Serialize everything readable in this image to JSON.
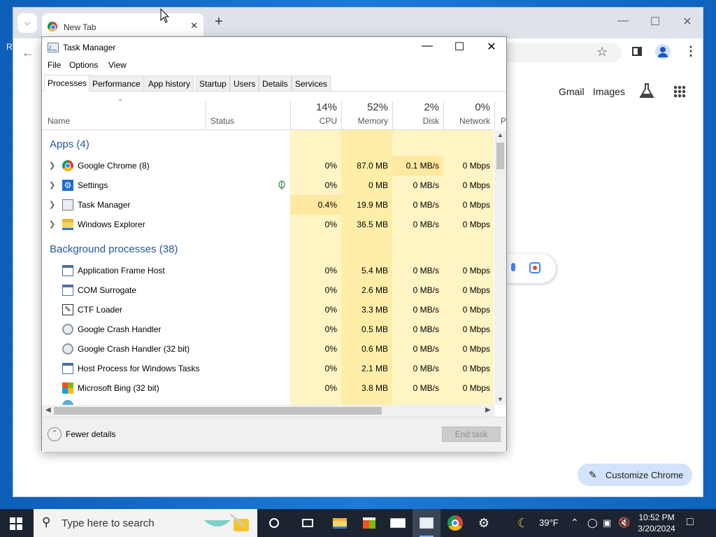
{
  "desktop": {
    "edge_text": "R"
  },
  "chrome": {
    "tab_list_icon": "chevron-down-icon",
    "tab": {
      "title": "New Tab",
      "close": "✕"
    },
    "new_tab": "+",
    "controls": {
      "minimize": "—",
      "maximize": "☐",
      "close": "✕"
    },
    "back": "←",
    "links": {
      "gmail": "Gmail",
      "images": "Images"
    },
    "customize_label": "Customize Chrome"
  },
  "task_manager": {
    "title": "Task Manager",
    "controls": {
      "minimize": "—",
      "maximize": "☐",
      "close": "✕"
    },
    "menu": [
      "File",
      "Options",
      "View"
    ],
    "tabs": [
      "Processes",
      "Performance",
      "App history",
      "Startup",
      "Users",
      "Details",
      "Services"
    ],
    "active_tab": "Processes",
    "columns": {
      "name": "Name",
      "status": "Status",
      "cpu": {
        "value": "14%",
        "label": "CPU"
      },
      "memory": {
        "value": "52%",
        "label": "Memory"
      },
      "disk": {
        "value": "2%",
        "label": "Disk"
      },
      "network": {
        "value": "0%",
        "label": "Network"
      },
      "power": "P"
    },
    "groups": {
      "apps": "Apps (4)",
      "background": "Background processes (38)"
    },
    "apps": [
      {
        "name": "Google Chrome (8)",
        "cpu": "0%",
        "memory": "87.0 MB",
        "disk": "0.1 MB/s",
        "network": "0 Mbps",
        "icon": "chrome-icon"
      },
      {
        "name": "Settings",
        "cpu": "0%",
        "memory": "0 MB",
        "disk": "0 MB/s",
        "network": "0 Mbps",
        "icon": "settings-gear-icon"
      },
      {
        "name": "Task Manager",
        "cpu": "0.4%",
        "memory": "19.9 MB",
        "disk": "0 MB/s",
        "network": "0 Mbps",
        "icon": "task-manager-icon"
      },
      {
        "name": "Windows Explorer",
        "cpu": "0%",
        "memory": "36.5 MB",
        "disk": "0 MB/s",
        "network": "0 Mbps",
        "icon": "folder-icon"
      }
    ],
    "background": [
      {
        "name": "Application Frame Host",
        "cpu": "0%",
        "memory": "5.4 MB",
        "disk": "0 MB/s",
        "network": "0 Mbps",
        "icon": "app-window-icon"
      },
      {
        "name": "COM Surrogate",
        "cpu": "0%",
        "memory": "2.6 MB",
        "disk": "0 MB/s",
        "network": "0 Mbps",
        "icon": "app-window-icon"
      },
      {
        "name": "CTF Loader",
        "cpu": "0%",
        "memory": "3.3 MB",
        "disk": "0 MB/s",
        "network": "0 Mbps",
        "icon": "pen-note-icon"
      },
      {
        "name": "Google Crash Handler",
        "cpu": "0%",
        "memory": "0.5 MB",
        "disk": "0 MB/s",
        "network": "0 Mbps",
        "icon": "crash-handler-icon"
      },
      {
        "name": "Google Crash Handler (32 bit)",
        "cpu": "0%",
        "memory": "0.6 MB",
        "disk": "0 MB/s",
        "network": "0 Mbps",
        "icon": "crash-handler-icon"
      },
      {
        "name": "Host Process for Windows Tasks",
        "cpu": "0%",
        "memory": "2.1 MB",
        "disk": "0 MB/s",
        "network": "0 Mbps",
        "icon": "app-window-icon"
      },
      {
        "name": "Microsoft Bing (32 bit)",
        "cpu": "0%",
        "memory": "3.8 MB",
        "disk": "0 MB/s",
        "network": "0 Mbps",
        "icon": "bing-tiles-icon"
      }
    ],
    "footer": {
      "fewer_details": "Fewer details",
      "end_task": "End task"
    }
  },
  "taskbar": {
    "search_placeholder": "Type here to search",
    "weather": "39°F",
    "time": "10:52 PM",
    "date": "3/20/2024"
  }
}
